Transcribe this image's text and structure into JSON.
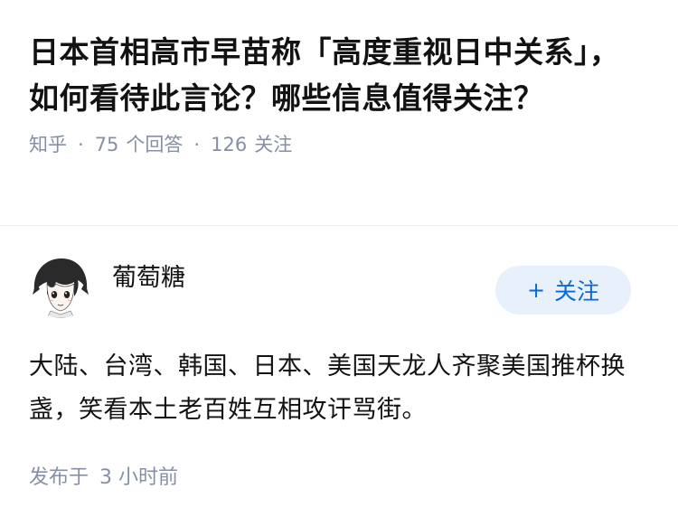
{
  "question": {
    "title": "日本首相高市早苗称「高度重视日中关系」，如何看待此言论？哪些信息值得关注？",
    "source": "知乎",
    "answer_count": "75",
    "answer_label": "个回答",
    "follow_count": "126",
    "follow_label": "关注",
    "separator": "·"
  },
  "answer": {
    "author_name": "葡萄糖",
    "follow_button": {
      "icon": "+",
      "label": "关注"
    },
    "content": "大陆、台湾、韩国、日本、美国天龙人齐聚美国推杯换盏，笑看本土老百姓互相攻讦骂街。",
    "published_label": "发布于",
    "published_time": "3 小时前"
  },
  "colors": {
    "accent": "#0a69d6",
    "accent_bg": "#e8f1fb",
    "meta_text": "#8590a6",
    "primary_text": "#121212"
  }
}
